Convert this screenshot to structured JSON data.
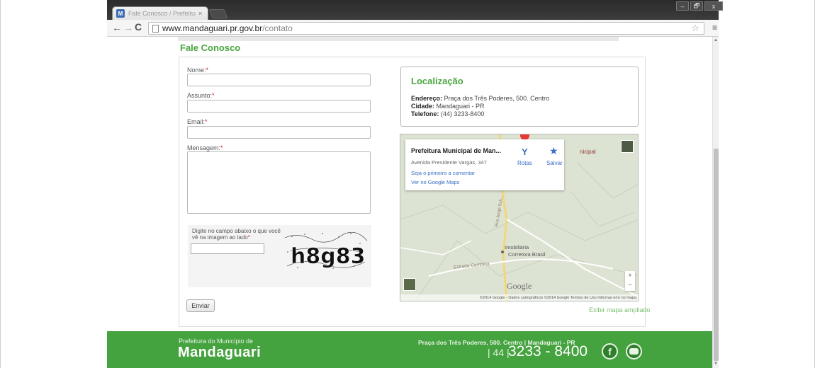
{
  "browser": {
    "tab_title": "Fale Conosco / Prefeitura",
    "tab_close": "×",
    "favicon_text": "M",
    "url_host": "www.mandaguari.pr.gov.br",
    "url_path": "/contato",
    "back_glyph": "←",
    "forward_glyph": "→",
    "reload_glyph": "C",
    "star_glyph": "☆",
    "menu_glyph": "≡",
    "window_minimize": "–",
    "window_maximize": "🗗",
    "window_close": "x"
  },
  "page": {
    "heading": "Fale Conosco",
    "form": {
      "name_label": "Nome:",
      "subject_label": "Assunto:",
      "email_label": "Email:",
      "message_label": "Mensagem:",
      "required_mark": "*",
      "captcha_prompt": "Digite no campo abaixo o que você vê na imagem ao lado",
      "captcha_image_text": "h8g83",
      "send_label": "Enviar"
    },
    "location": {
      "title": "Localização",
      "address_label": "Endereço:",
      "address_value": " Praça dos Três Poderes, 500. Centro",
      "city_label": "Cidade:",
      "city_value": " Mandaguari - PR",
      "phone_label": "Telefone:",
      "phone_value": " (44) 3233-8400"
    },
    "map": {
      "place_name": "Prefeitura Municipal de Man...",
      "place_address": "Avenida Presidente Vargas, 347",
      "first_comment_link": "Seja o primeiro a comentar",
      "view_maps_link": "Ver no Google Maps",
      "rotas": "Rotas",
      "salvar": "Salvar",
      "label_municipal": "nicipal",
      "label_imob1": "Imobiliária",
      "label_imob2": "Corretora Brasil",
      "label_estrada": "Estrada Cambeta",
      "label_rua": "Rua Jorge Sch...",
      "google_logo": "Google",
      "footer": "©2014 Google - Dados cartográficos ©2014 Google   Termos de Uso   Informar erro no mapa",
      "zoom_in": "+",
      "zoom_out": "−"
    },
    "map_expand_link": "Exibir mapa ampliado"
  },
  "footer": {
    "line1": "Prefeitura do Município de",
    "line2": "Mandaguari",
    "address": "Praça dos Três Poderes, 500. Centro | Mandaguari - PR",
    "ddd": "| 44 |",
    "phone": "3233 - 8400",
    "fb_glyph": "f"
  },
  "colors": {
    "brand_green": "#44a23f",
    "heading_green": "#4aa640",
    "link_blue": "#3a6fc3",
    "required_red": "#d42424"
  }
}
